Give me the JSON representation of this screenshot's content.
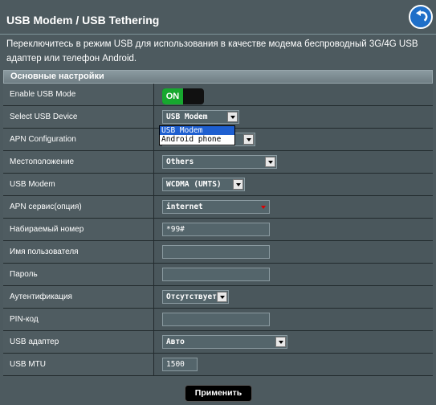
{
  "header": {
    "title": "USB Modem / USB Tethering"
  },
  "description": "Переключитесь в режим USB для использования в качестве модема беспроводный 3G/4G USB адаптер или телефон Android.",
  "section": {
    "title": "Основные настройки"
  },
  "rows": {
    "enable_usb_mode": {
      "label": "Enable USB Mode",
      "toggle": "ON"
    },
    "select_usb_device": {
      "label": "Select USB Device",
      "value": "USB Modem"
    },
    "apn_configuration": {
      "label": "APN Configuration",
      "value": ""
    },
    "location": {
      "label": "Местоположение",
      "value": "Others"
    },
    "usb_modem": {
      "label": "USB Modem",
      "value": "WCDMA (UMTS)"
    },
    "apn_service": {
      "label": "APN сервис(опция)",
      "value": "internet"
    },
    "dial_number": {
      "label": "Набираемый номер",
      "value": "*99#"
    },
    "username": {
      "label": "Имя пользователя",
      "value": ""
    },
    "password": {
      "label": "Пароль",
      "value": ""
    },
    "authentication": {
      "label": "Аутентификация",
      "value": "Отсутствует"
    },
    "pin": {
      "label": "PIN-код",
      "value": ""
    },
    "usb_adapter": {
      "label": "USB адаптер",
      "value": "Авто"
    },
    "usb_mtu": {
      "label": "USB MTU",
      "value": "1500"
    }
  },
  "dropdown_options": [
    "USB Modem",
    "Android phone"
  ],
  "apply_label": "Применить",
  "colors": {
    "background": "#4d5a5f",
    "toggle_on": "#17a82f",
    "highlight": "#1e5fd0",
    "back_button": "#1f6fc8"
  }
}
